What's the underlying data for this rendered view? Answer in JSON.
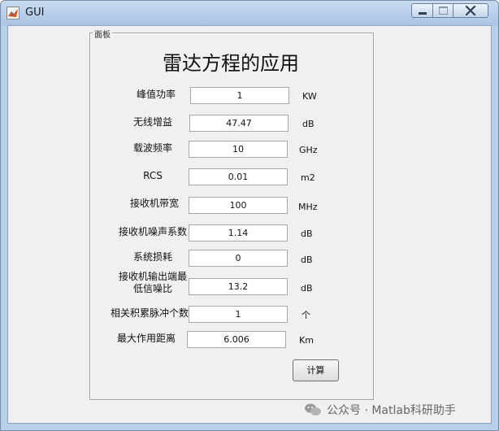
{
  "window": {
    "title": "GUI"
  },
  "panel": {
    "title": "面板",
    "heading": "雷达方程的应用",
    "fields": [
      {
        "label": "峰值功率",
        "value": "1",
        "unit": "KW"
      },
      {
        "label": "无线增益",
        "value": "47.47",
        "unit": "dB"
      },
      {
        "label": "载波频率",
        "value": "10",
        "unit": "GHz"
      },
      {
        "label": "RCS",
        "value": "0.01",
        "unit": "m2"
      },
      {
        "label": "接收机带宽",
        "value": "100",
        "unit": "MHz"
      },
      {
        "label": "接收机噪声系数",
        "value": "1.14",
        "unit": "dB"
      },
      {
        "label": "系统损耗",
        "value": "0",
        "unit": "dB"
      },
      {
        "label": "接收机输出端最低信噪比",
        "label_line1": "接收机输出端最",
        "label_line2": "低信噪比",
        "value": "13.2",
        "unit": "dB"
      },
      {
        "label": "相关积累脉冲个数",
        "value": "1",
        "unit": "个"
      },
      {
        "label": "最大作用距离",
        "value": "6.006",
        "unit": "Km"
      }
    ],
    "calc_button": "计算"
  },
  "watermark": {
    "text": "公众号 · Matlab科研助手"
  },
  "colors": {
    "client_bg": "#f0f0f0",
    "titlebar": "#b9d0ea"
  }
}
